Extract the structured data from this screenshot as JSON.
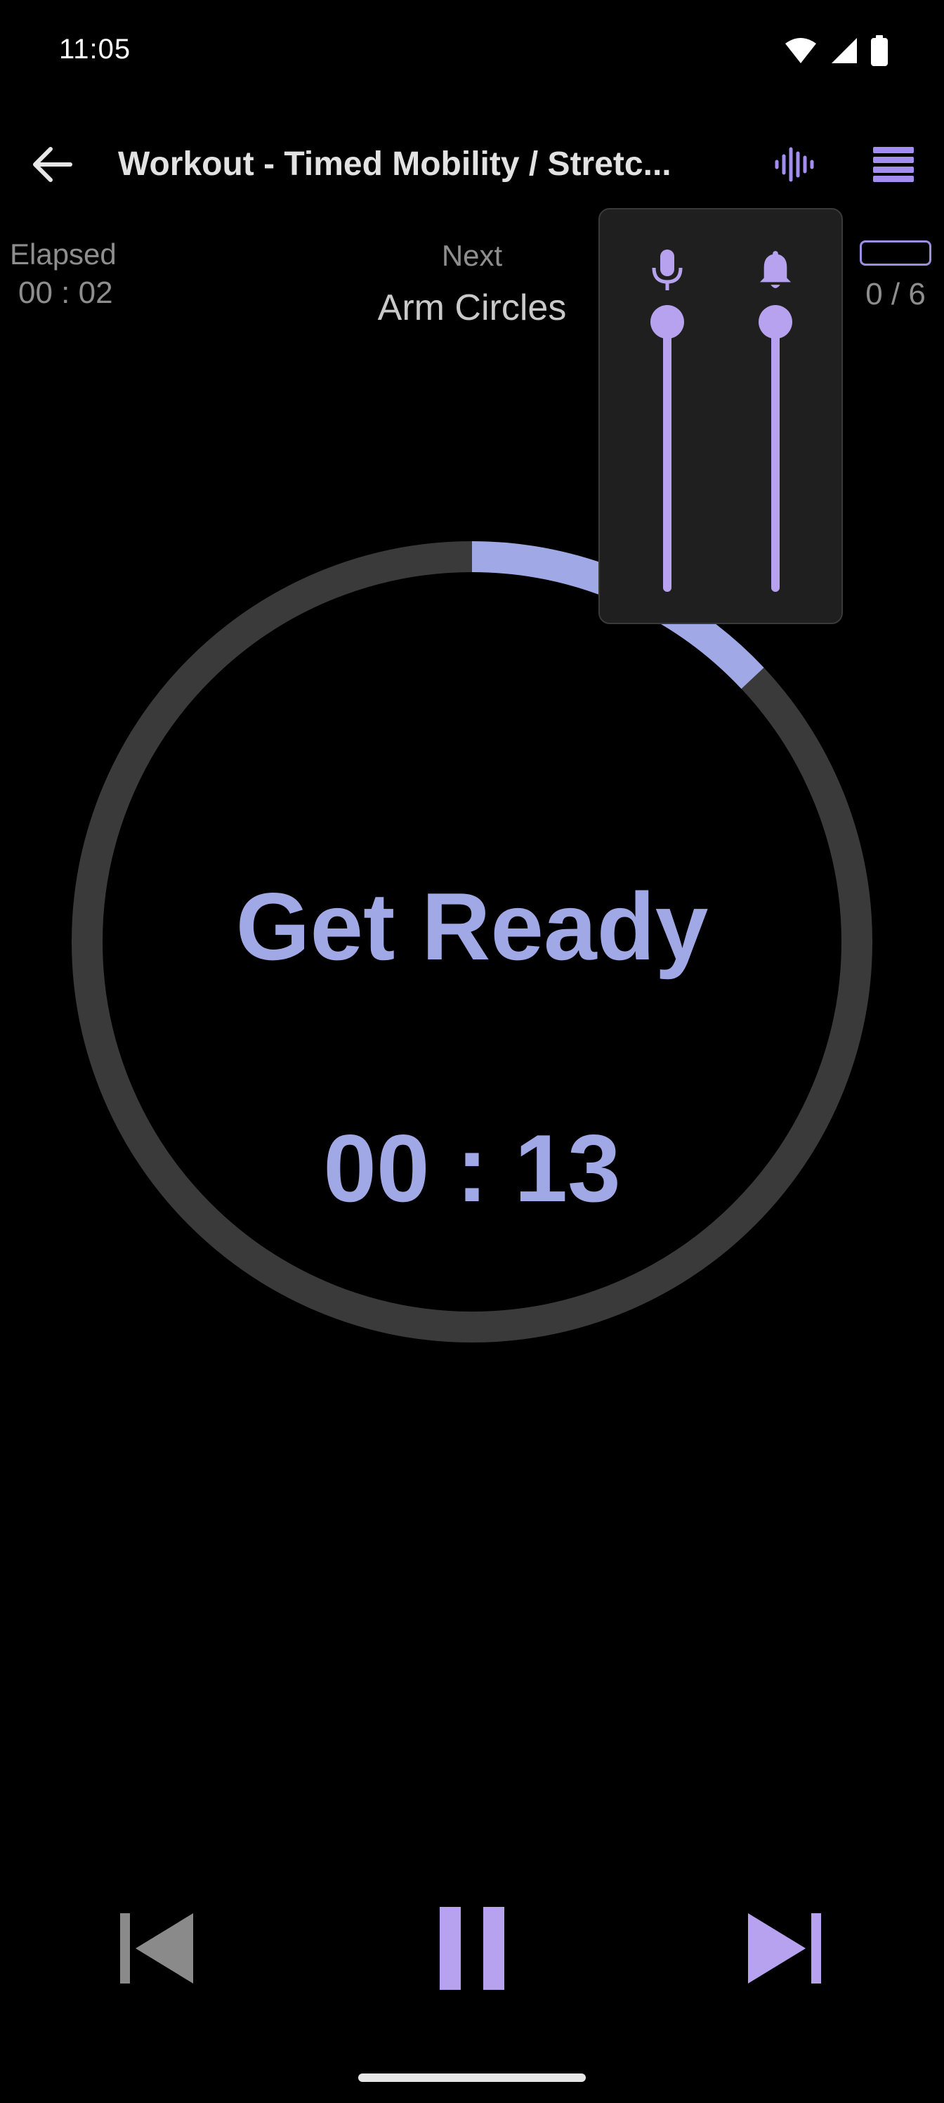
{
  "status_bar": {
    "time": "11:05",
    "icons": [
      "wifi-icon",
      "cell-signal-icon",
      "battery-icon"
    ]
  },
  "app_bar": {
    "title": "Workout - Timed Mobility / Stretc...",
    "back_icon": "arrow-back-icon",
    "voice_icon": "voice-waveform-icon",
    "menu_icon": "menu-icon"
  },
  "info": {
    "elapsed_label": "Elapsed",
    "elapsed_value": "00 : 02",
    "next_label": "Next",
    "next_value": "Arm Circles",
    "progress_count": "0 / 6",
    "progress_fraction": 0
  },
  "timer": {
    "phase_label": "Get Ready",
    "countdown": "00 : 13",
    "ring_progress_fraction": 0.13
  },
  "volume_panel": {
    "sliders": [
      {
        "icon": "microphone-icon",
        "level": 1.0
      },
      {
        "icon": "bell-icon",
        "level": 1.0
      }
    ]
  },
  "controls": {
    "prev_icon": "skip-previous-icon",
    "pause_icon": "pause-icon",
    "next_icon": "skip-next-icon"
  },
  "colors": {
    "background": "#000000",
    "accent": "#a1a8e6",
    "accent_purple": "#b7a2ef",
    "ring_track": "#3a3a3a",
    "muted_text": "#8e8e8e"
  }
}
